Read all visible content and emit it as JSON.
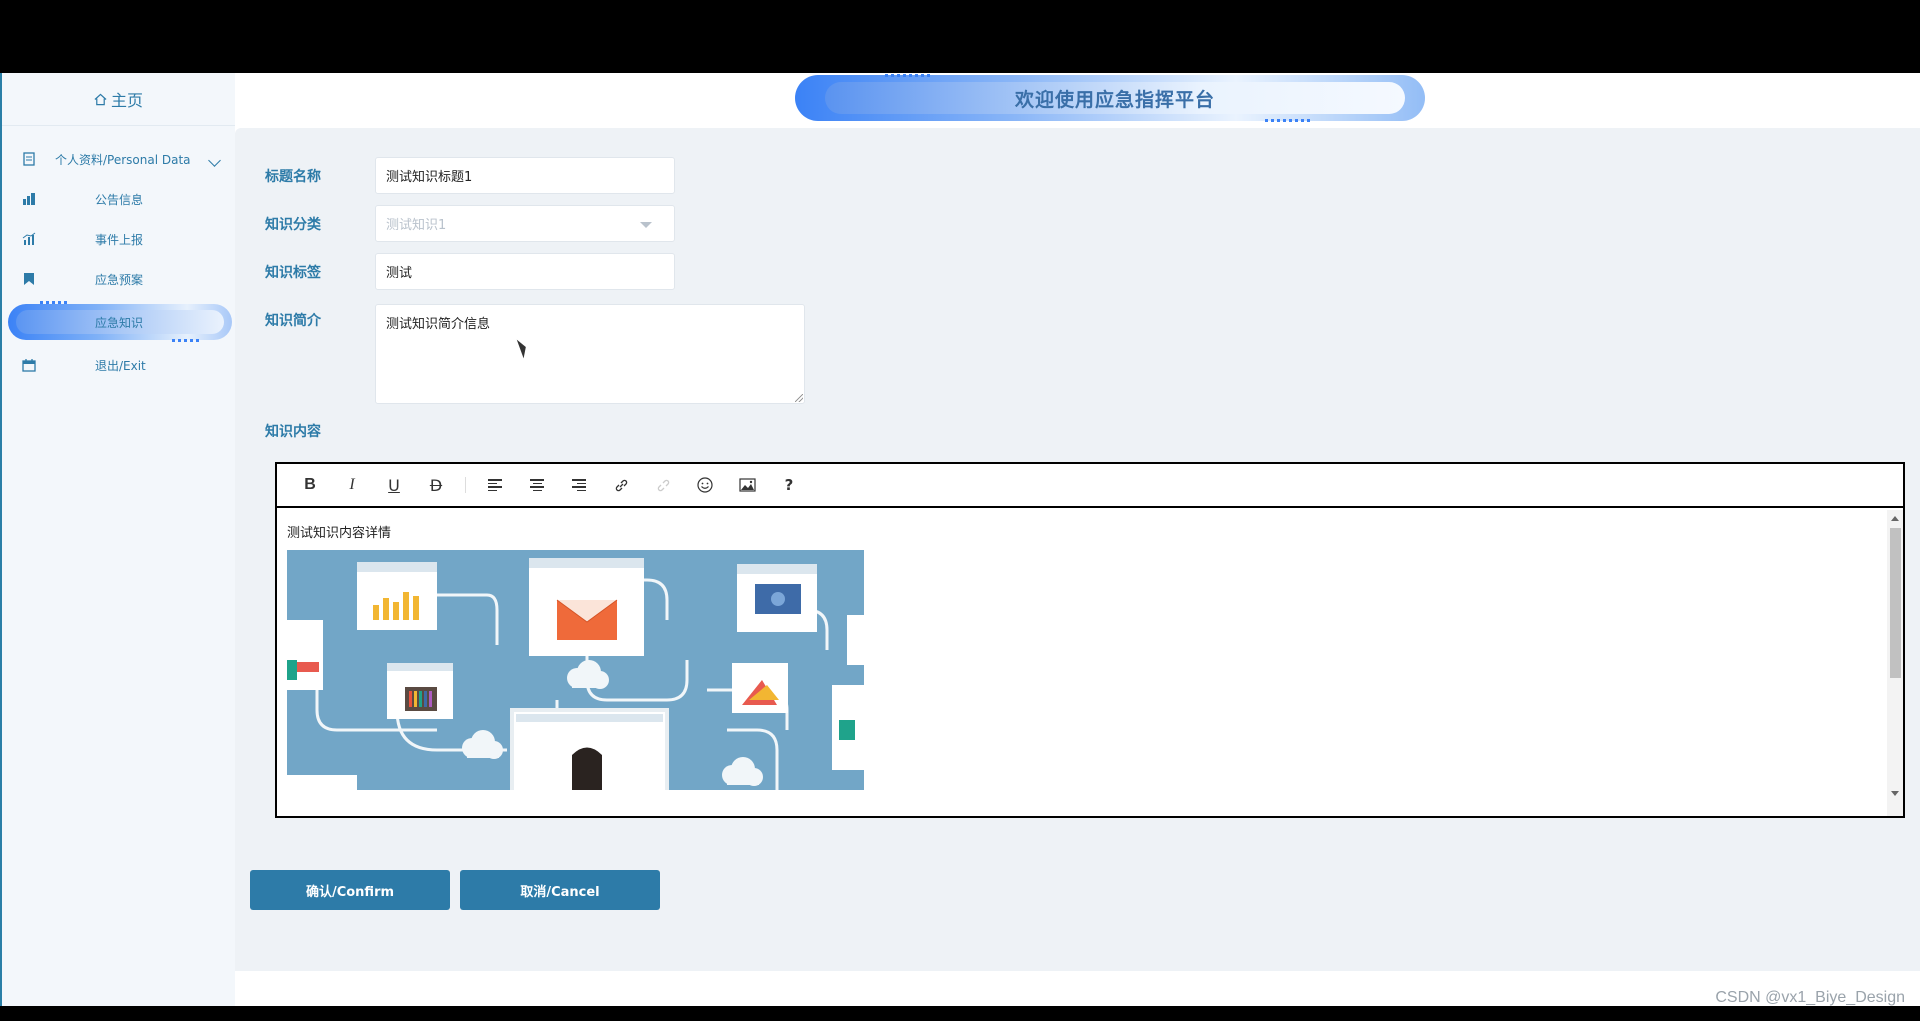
{
  "header": {
    "title": "欢迎使用应急指挥平台"
  },
  "sidebar": {
    "home": {
      "label": "主页",
      "icon": "home-icon"
    },
    "items": [
      {
        "label": "个人资料/Personal Data",
        "icon": "document-icon",
        "expandable": true
      },
      {
        "label": "公告信息",
        "icon": "building-chart-icon"
      },
      {
        "label": "事件上报",
        "icon": "bar-chart-icon"
      },
      {
        "label": "应急预案",
        "icon": "bookmark-icon"
      },
      {
        "label": "应急知识",
        "icon": "none",
        "active": true
      },
      {
        "label": "退出/Exit",
        "icon": "calendar-icon"
      }
    ]
  },
  "form": {
    "title_label": "标题名称",
    "title_value": "测试知识标题1",
    "category_label": "知识分类",
    "category_value": "测试知识1",
    "tag_label": "知识标签",
    "tag_value": "测试",
    "intro_label": "知识简介",
    "intro_value": "测试知识简介信息",
    "content_label": "知识内容"
  },
  "editor": {
    "toolbar": [
      "B",
      "I",
      "U",
      "D",
      "align-left",
      "align-center",
      "align-right",
      "link",
      "unlink",
      "emoji",
      "image",
      "?"
    ],
    "content_text": "测试知识内容详情",
    "image_alt": "network illustration"
  },
  "buttons": {
    "confirm": "确认/Confirm",
    "cancel": "取消/Cancel"
  },
  "watermark": "CSDN @vx1_Biye_Design",
  "colors": {
    "accent": "#2d7ba8",
    "background": "#eef2f6",
    "sidebar": "#f3f7fb"
  }
}
